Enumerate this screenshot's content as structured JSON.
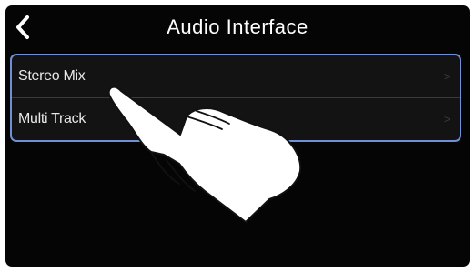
{
  "header": {
    "title": "Audio Interface",
    "back_icon": "chevron-left-icon"
  },
  "menu": {
    "items": [
      {
        "label": "Stereo Mix",
        "chevron": ">"
      },
      {
        "label": "Multi Track",
        "chevron": ">"
      }
    ]
  },
  "colors": {
    "background": "#050505",
    "selection_border": "#6f8fd6",
    "text": "#e8e8e8"
  },
  "gesture": {
    "icon": "tap-hand-icon"
  }
}
